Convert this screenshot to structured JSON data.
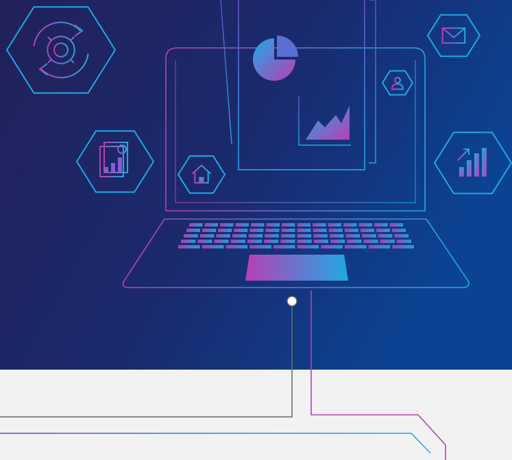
{
  "scene": {
    "type": "illustration",
    "subject": "laptop-with-floating-report-and-icons",
    "colors": {
      "background_top": "#1d1f5e",
      "background_right": "#0e3d8f",
      "page_background": "#f2f2f2",
      "accent_cyan": "#1fa9e4",
      "accent_magenta": "#b73fb4",
      "accent_purple": "#6a4ec9",
      "connector_gray": "#666666"
    },
    "icons": [
      "gear-cycle-icon",
      "report-gear-icon",
      "home-icon",
      "envelope-icon",
      "user-icon",
      "growth-chart-icon",
      "pie-chart-icon",
      "area-chart-icon"
    ]
  }
}
